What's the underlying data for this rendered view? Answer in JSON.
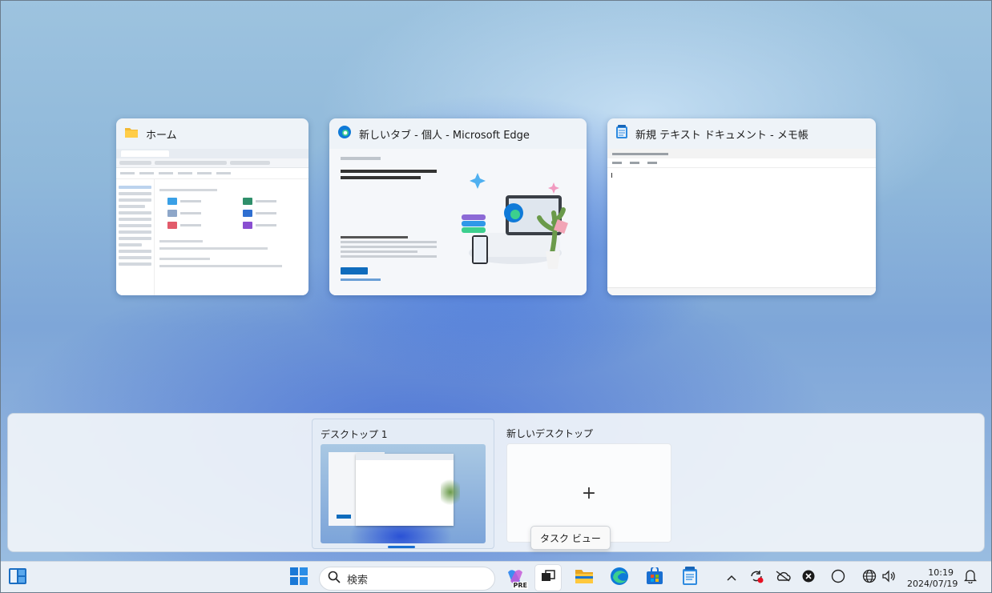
{
  "windows": [
    {
      "title": "ホーム",
      "icon": "folder-icon"
    },
    {
      "title": "新しいタブ - 個人 - Microsoft Edge",
      "icon": "edge-icon"
    },
    {
      "title": "新規 テキスト ドキュメント - メモ帳",
      "icon": "notepad-icon"
    }
  ],
  "desktops": {
    "current_label": "デスクトップ 1",
    "new_label": "新しいデスクトップ",
    "new_symbol": "+"
  },
  "tooltip": "タスク ビュー",
  "taskbar": {
    "search_label": "検索",
    "apps": [
      "widgets-icon",
      "start-icon",
      "copilot-icon",
      "task-view-icon",
      "file-explorer-icon",
      "edge-icon",
      "store-icon",
      "notepad-icon"
    ],
    "copilot_badge": "PRE",
    "tray": [
      "chevron-up-icon",
      "sync-icon",
      "onedrive-icon",
      "close-circle-icon",
      "moon-icon",
      "language-icon",
      "volume-icon",
      "notification-icon"
    ],
    "time": "10:19",
    "date": "2024/07/19"
  },
  "colors": {
    "accent": "#1a6fd1",
    "folder": "#f2b934",
    "edge": "#0f7ad8"
  }
}
